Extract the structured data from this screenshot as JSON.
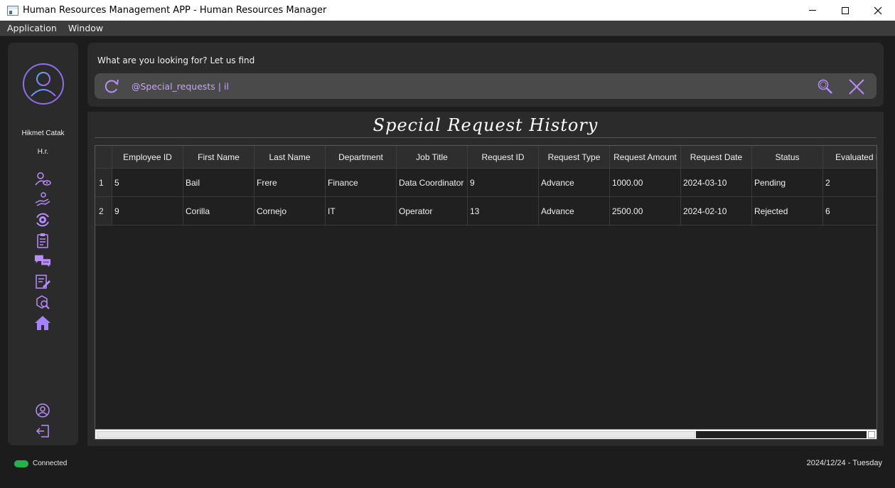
{
  "window": {
    "title": "Human Resources Management APP - Human Resources Manager"
  },
  "menu": [
    "Application",
    "Window"
  ],
  "user": {
    "name": "Hikmet Catak",
    "role": "H.r."
  },
  "sidebar_icons": [
    "employee-view-icon",
    "hand-request-icon",
    "settings-cycle-icon",
    "clipboard-icon",
    "chat-icon",
    "document-edit-icon",
    "search-box-icon",
    "home-icon"
  ],
  "sidebar_bottom_icons": [
    "profile-icon",
    "logout-icon"
  ],
  "search": {
    "prompt": "What are you looking for? Let us find",
    "value": "@Special_requests | il"
  },
  "section": {
    "title": "Special Request History"
  },
  "table": {
    "columns": [
      "Employee ID",
      "First Name",
      "Last Name",
      "Department",
      "Job Title",
      "Request ID",
      "Request Type",
      "Request Amount",
      "Request Date",
      "Status",
      "Evaluated B"
    ],
    "rows": [
      {
        "num": "1",
        "cells": [
          "5",
          "Bail",
          "Frere",
          "Finance",
          "Data Coordinator",
          "9",
          "Advance",
          "1000.00",
          "2024-03-10",
          "Pending",
          "2"
        ]
      },
      {
        "num": "2",
        "cells": [
          "9",
          "Corilla",
          "Cornejo",
          "IT",
          "Operator",
          "13",
          "Advance",
          "2500.00",
          "2024-02-10",
          "Rejected",
          "6"
        ]
      }
    ]
  },
  "status": {
    "connection": "Connected",
    "date": "2024/12/24 - Tuesday"
  },
  "colors": {
    "accent": "#9b6dff",
    "connected": "#24b24a"
  }
}
